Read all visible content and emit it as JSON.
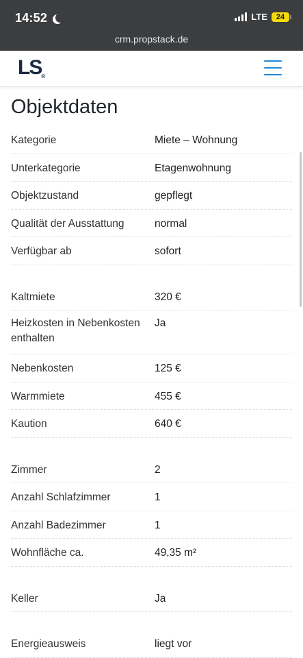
{
  "status_bar": {
    "time": "14:52",
    "network": "LTE",
    "battery": "24",
    "url": "crm.propstack.de"
  },
  "navbar": {
    "logo": "LS",
    "logo_mark": "®"
  },
  "page": {
    "title": "Objektdaten"
  },
  "groups": [
    [
      {
        "label": "Kategorie",
        "value": "Miete – Wohnung"
      },
      {
        "label": "Unterkategorie",
        "value": "Etagenwohnung"
      },
      {
        "label": "Objektzustand",
        "value": "gepflegt"
      },
      {
        "label": "Qualität der Ausstattung",
        "value": "normal"
      },
      {
        "label": "Verfügbar ab",
        "value": "sofort"
      }
    ],
    [
      {
        "label": "Kaltmiete",
        "value": "320 €"
      },
      {
        "label": "Heizkosten in Nebenkosten enthalten",
        "value": "Ja"
      },
      {
        "label": "Nebenkosten",
        "value": "125 €"
      },
      {
        "label": "Warmmiete",
        "value": "455 €"
      },
      {
        "label": "Kaution",
        "value": "640 €"
      }
    ],
    [
      {
        "label": "Zimmer",
        "value": "2"
      },
      {
        "label": "Anzahl Schlafzimmer",
        "value": "1"
      },
      {
        "label": "Anzahl Badezimmer",
        "value": "1"
      },
      {
        "label": "Wohnfläche ca.",
        "value": "49,35 m²"
      }
    ],
    [
      {
        "label": "Keller",
        "value": "Ja"
      }
    ],
    [
      {
        "label": "Energieausweis",
        "value": "liegt vor"
      }
    ]
  ]
}
